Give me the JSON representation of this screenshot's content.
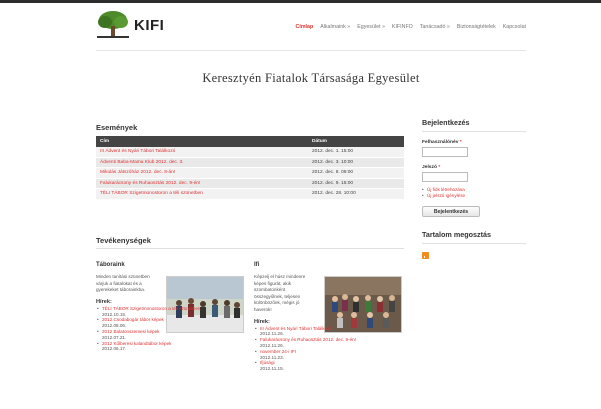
{
  "logo": {
    "text": "KIFI"
  },
  "nav": [
    {
      "label": "Címlap",
      "active": true
    },
    {
      "label": "Alkalmaink »",
      "active": false
    },
    {
      "label": "Egyesület »",
      "active": false
    },
    {
      "label": "KIFINFO",
      "active": false
    },
    {
      "label": "Tanácsadó »",
      "active": false
    },
    {
      "label": "Biztonságtételek",
      "active": false
    },
    {
      "label": "Kapcsolat",
      "active": false
    }
  ],
  "site_title": "Keresztyén Fiatalok Társasága Egyesület",
  "events": {
    "title": "Események",
    "col_title": "Cím",
    "col_date": "Dátum",
    "rows": [
      {
        "title": "III Ádvent és Nyári Tábori Találkozó",
        "date": "2012. dec. 1. 15:00"
      },
      {
        "title": "Ádventi Baba-Mama Klub 2012. dec. 3.",
        "date": "2012. dec. 3. 10:00"
      },
      {
        "title": "Mikulás Játszóház 2012. dec. 8-án!",
        "date": "2012. dec. 8. 09:00"
      },
      {
        "title": "Falukarácsony és Ruhaosztás 2012. dec. 9-én!",
        "date": "2012. dec. 9. 15:00"
      },
      {
        "title": "TÉLI TÁBOR Szigetmonostoron a téli szünetben",
        "date": "2012. dec. 28. 10:00"
      }
    ]
  },
  "activities": {
    "title": "Tevékenységek",
    "left": {
      "heading": "Táboraink",
      "desc": "Minden tanítási szünetben várjuk a fiatalokat és a gyerekeket táborainkba.",
      "news_label": "Hírek:",
      "news": [
        {
          "title": "TÉLI TÁBOR Szigetmonostoron a téli szünetben",
          "date": "2012.10.15."
        },
        {
          "title": "2012 Csodabogár tábor képek",
          "date": "2012.08.06."
        },
        {
          "title": "2012 Balatonszemesi képek",
          "date": "2012.07.21."
        },
        {
          "title": "2012 Kűlberesi kalandtábor képek",
          "date": "2012.06.17."
        }
      ]
    },
    "right": {
      "heading": "Ifi",
      "desc": "Képzelj el húsz mindenre képes figurát, akik szombatonként összegyűlnek, teljesen különbözőek, mégis jó haverok!",
      "news_label": "Hírek:",
      "news": [
        {
          "title": "III Ádvent és Nyári Tábori Találkozó",
          "date": "2012.11.26."
        },
        {
          "title": "Falukarácsony és Ruhaosztás 2012. dec. 9-én!",
          "date": "2012.11.26."
        },
        {
          "title": "november 24-i IFI",
          "date": "2012.11.23."
        },
        {
          "title": "Ifjúsági",
          "date": "2012.11.15."
        }
      ]
    }
  },
  "login": {
    "title": "Bejelentkezés",
    "username_label": "Felhasználónév",
    "password_label": "Jelszó",
    "required_mark": "*",
    "links": [
      "Új fiók létrehozása",
      "Új jelszó igénylése"
    ],
    "button": "Bejelentkezés"
  },
  "share": {
    "title": "Tartalom megosztás",
    "icon": "rss-icon"
  },
  "colors": {
    "accent": "#dd3333",
    "table_header": "#444444",
    "rss": "#f28b1e"
  }
}
